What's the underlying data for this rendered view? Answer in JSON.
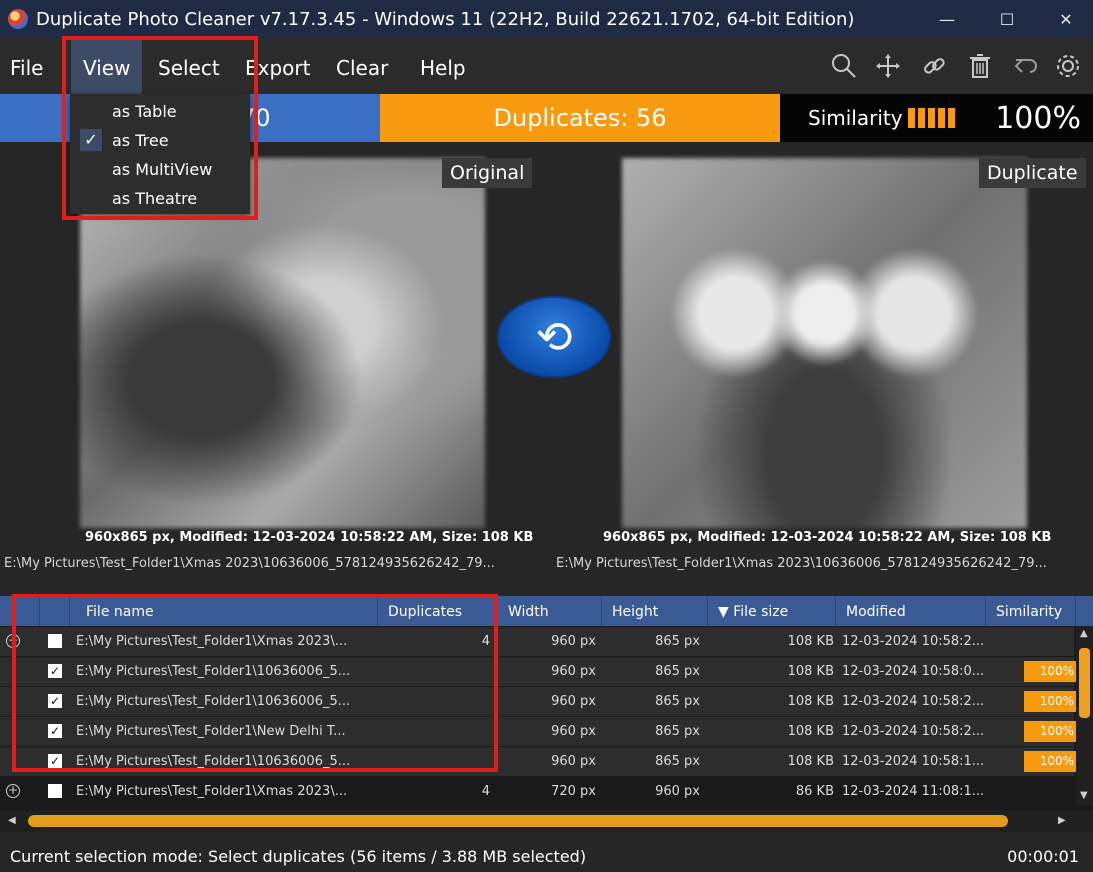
{
  "window": {
    "title": "Duplicate Photo Cleaner v7.17.3.45 - Windows 11 (22H2, Build 22621.1702, 64-bit Edition)",
    "minimize": "—",
    "maximize": "☐",
    "close": "✕"
  },
  "menu": {
    "items": [
      "File",
      "View",
      "Select",
      "Export",
      "Clear",
      "Help"
    ],
    "active": "View"
  },
  "toolbar_icons": [
    "search-icon",
    "move-icon",
    "link-icon",
    "trash-icon",
    "undo-icon",
    "settings-icon"
  ],
  "view_menu": {
    "items": [
      "as Table",
      "as Tree",
      "as MultiView",
      "as Theatre"
    ],
    "checked": "as Tree"
  },
  "status_band": {
    "left_count": "70",
    "duplicates": "Duplicates: 56",
    "similarity_label": "Similarity",
    "similarity_value": "100%"
  },
  "viewer": {
    "original_label": "Original",
    "duplicate_label": "Duplicate",
    "original_meta": "960x865 px, Modified: 12-03-2024 10:58:22 AM, Size: 108 KB",
    "duplicate_meta": "960x865 px, Modified: 12-03-2024 10:58:22 AM, Size: 108 KB",
    "original_path": "E:\\My Pictures\\Test_Folder1\\Xmas 2023\\10636006_578124935626242_79...",
    "duplicate_path": "E:\\My Pictures\\Test_Folder1\\Xmas 2023\\10636006_578124935626242_79..."
  },
  "table": {
    "columns": [
      "File name",
      "Duplicates",
      "Width",
      "Height",
      "▼ File size",
      "Modified",
      "Similarity"
    ],
    "rows": [
      {
        "type": "group",
        "expand": "−",
        "checked": false,
        "name": "E:\\My Pictures\\Test_Folder1\\Xmas 2023\\...",
        "duplicates": "4",
        "width": "960 px",
        "height": "865 px",
        "size": "108 KB",
        "modified": "12-03-2024 10:58:2...",
        "similarity": ""
      },
      {
        "type": "child",
        "checked": true,
        "name": "E:\\My Pictures\\Test_Folder1\\10636006_5...",
        "duplicates": "",
        "width": "960 px",
        "height": "865 px",
        "size": "108 KB",
        "modified": "12-03-2024 10:58:0...",
        "similarity": "100%"
      },
      {
        "type": "child",
        "checked": true,
        "name": "E:\\My Pictures\\Test_Folder1\\10636006_5...",
        "duplicates": "",
        "width": "960 px",
        "height": "865 px",
        "size": "108 KB",
        "modified": "12-03-2024 10:58:2...",
        "similarity": "100%"
      },
      {
        "type": "child",
        "checked": true,
        "name": "E:\\My Pictures\\Test_Folder1\\New Delhi T...",
        "duplicates": "",
        "width": "960 px",
        "height": "865 px",
        "size": "108 KB",
        "modified": "12-03-2024 10:58:2...",
        "similarity": "100%"
      },
      {
        "type": "child",
        "checked": true,
        "name": "E:\\My Pictures\\Test_Folder1\\10636006_5...",
        "duplicates": "",
        "width": "960 px",
        "height": "865 px",
        "size": "108 KB",
        "modified": "12-03-2024 10:58:1...",
        "similarity": "100%"
      },
      {
        "type": "group",
        "expand": "+",
        "checked": false,
        "name": "E:\\My Pictures\\Test_Folder1\\Xmas 2023\\...",
        "duplicates": "4",
        "width": "720 px",
        "height": "960 px",
        "size": "86 KB",
        "modified": "12-03-2024 11:08:1...",
        "similarity": ""
      }
    ]
  },
  "statusbar": {
    "text": "Current selection mode: Select duplicates (56 items / 3.88 MB selected)",
    "timer": "00:00:01"
  },
  "colors": {
    "accent_blue": "#3b6fc4",
    "accent_orange": "#f79a0e",
    "highlight_red": "#e01e1e"
  }
}
